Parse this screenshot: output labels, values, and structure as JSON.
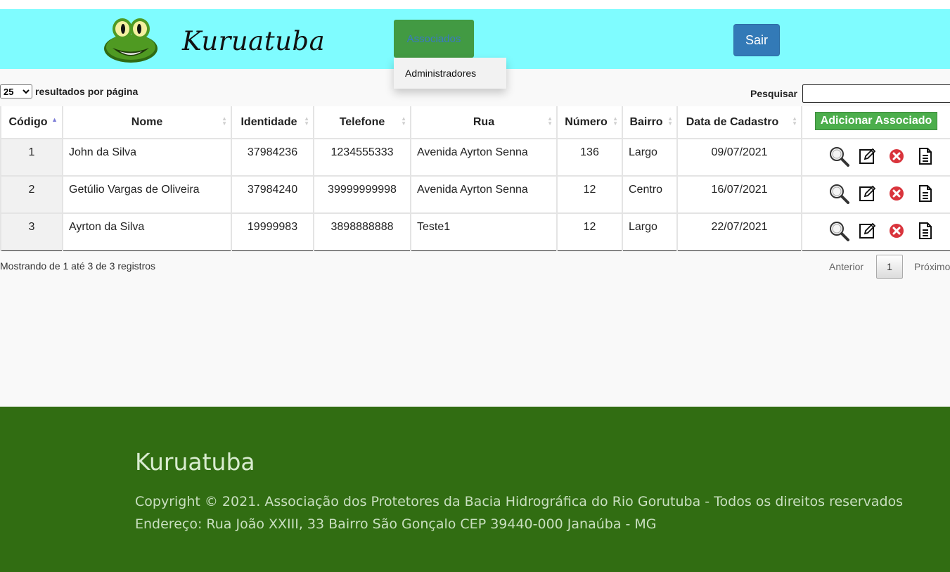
{
  "header": {
    "logo_text": "Kuruatuba",
    "nav_associados": "Associados",
    "dropdown_item": "Administradores",
    "sair_label": "Sair"
  },
  "controls": {
    "page_length_value": "25",
    "page_length_suffix": "resultados por página",
    "search_label": "Pesquisar",
    "search_value": ""
  },
  "table": {
    "columns": [
      "Código",
      "Nome",
      "Identidade",
      "Telefone",
      "Rua",
      "Número",
      "Bairro",
      "Data de Cadastro"
    ],
    "add_button": "Adicionar Associado",
    "rows": [
      [
        "1",
        "John da Silva",
        "37984236",
        "1234555333",
        "Avenida Ayrton Senna",
        "136",
        "Largo",
        "09/07/2021"
      ],
      [
        "2",
        "Getúlio Vargas de Oliveira",
        "37984240",
        "39999999998",
        "Avenida Ayrton Senna",
        "12",
        "Centro",
        "16/07/2021"
      ],
      [
        "3",
        "Ayrton da Silva",
        "19999983",
        "3898888888",
        "Teste1",
        "12",
        "Largo",
        "22/07/2021"
      ]
    ],
    "row_actions": [
      "magnifier-icon",
      "edit-icon",
      "delete-icon",
      "document-icon"
    ]
  },
  "footer_info": {
    "showing": "Mostrando de 1 até 3 de 3 registros",
    "prev": "Anterior",
    "page": "1",
    "next": "Próximo"
  },
  "footer": {
    "title": "Kuruatuba",
    "copyright": "Copyright © 2021. Associação dos Protetores da Bacia Hidrográfica do Rio Gorutuba - Todos os direitos reservados",
    "address": "Endereço: Rua João XXIII, 33 Bairro São Gonçalo CEP 39440-000 Janaúba - MG"
  },
  "colors": {
    "header_bg": "#7ffcff",
    "nav_green": "#429a43",
    "sair_blue": "#337ab7",
    "add_green": "#4cae4c",
    "footer_bg": "#316d12"
  }
}
